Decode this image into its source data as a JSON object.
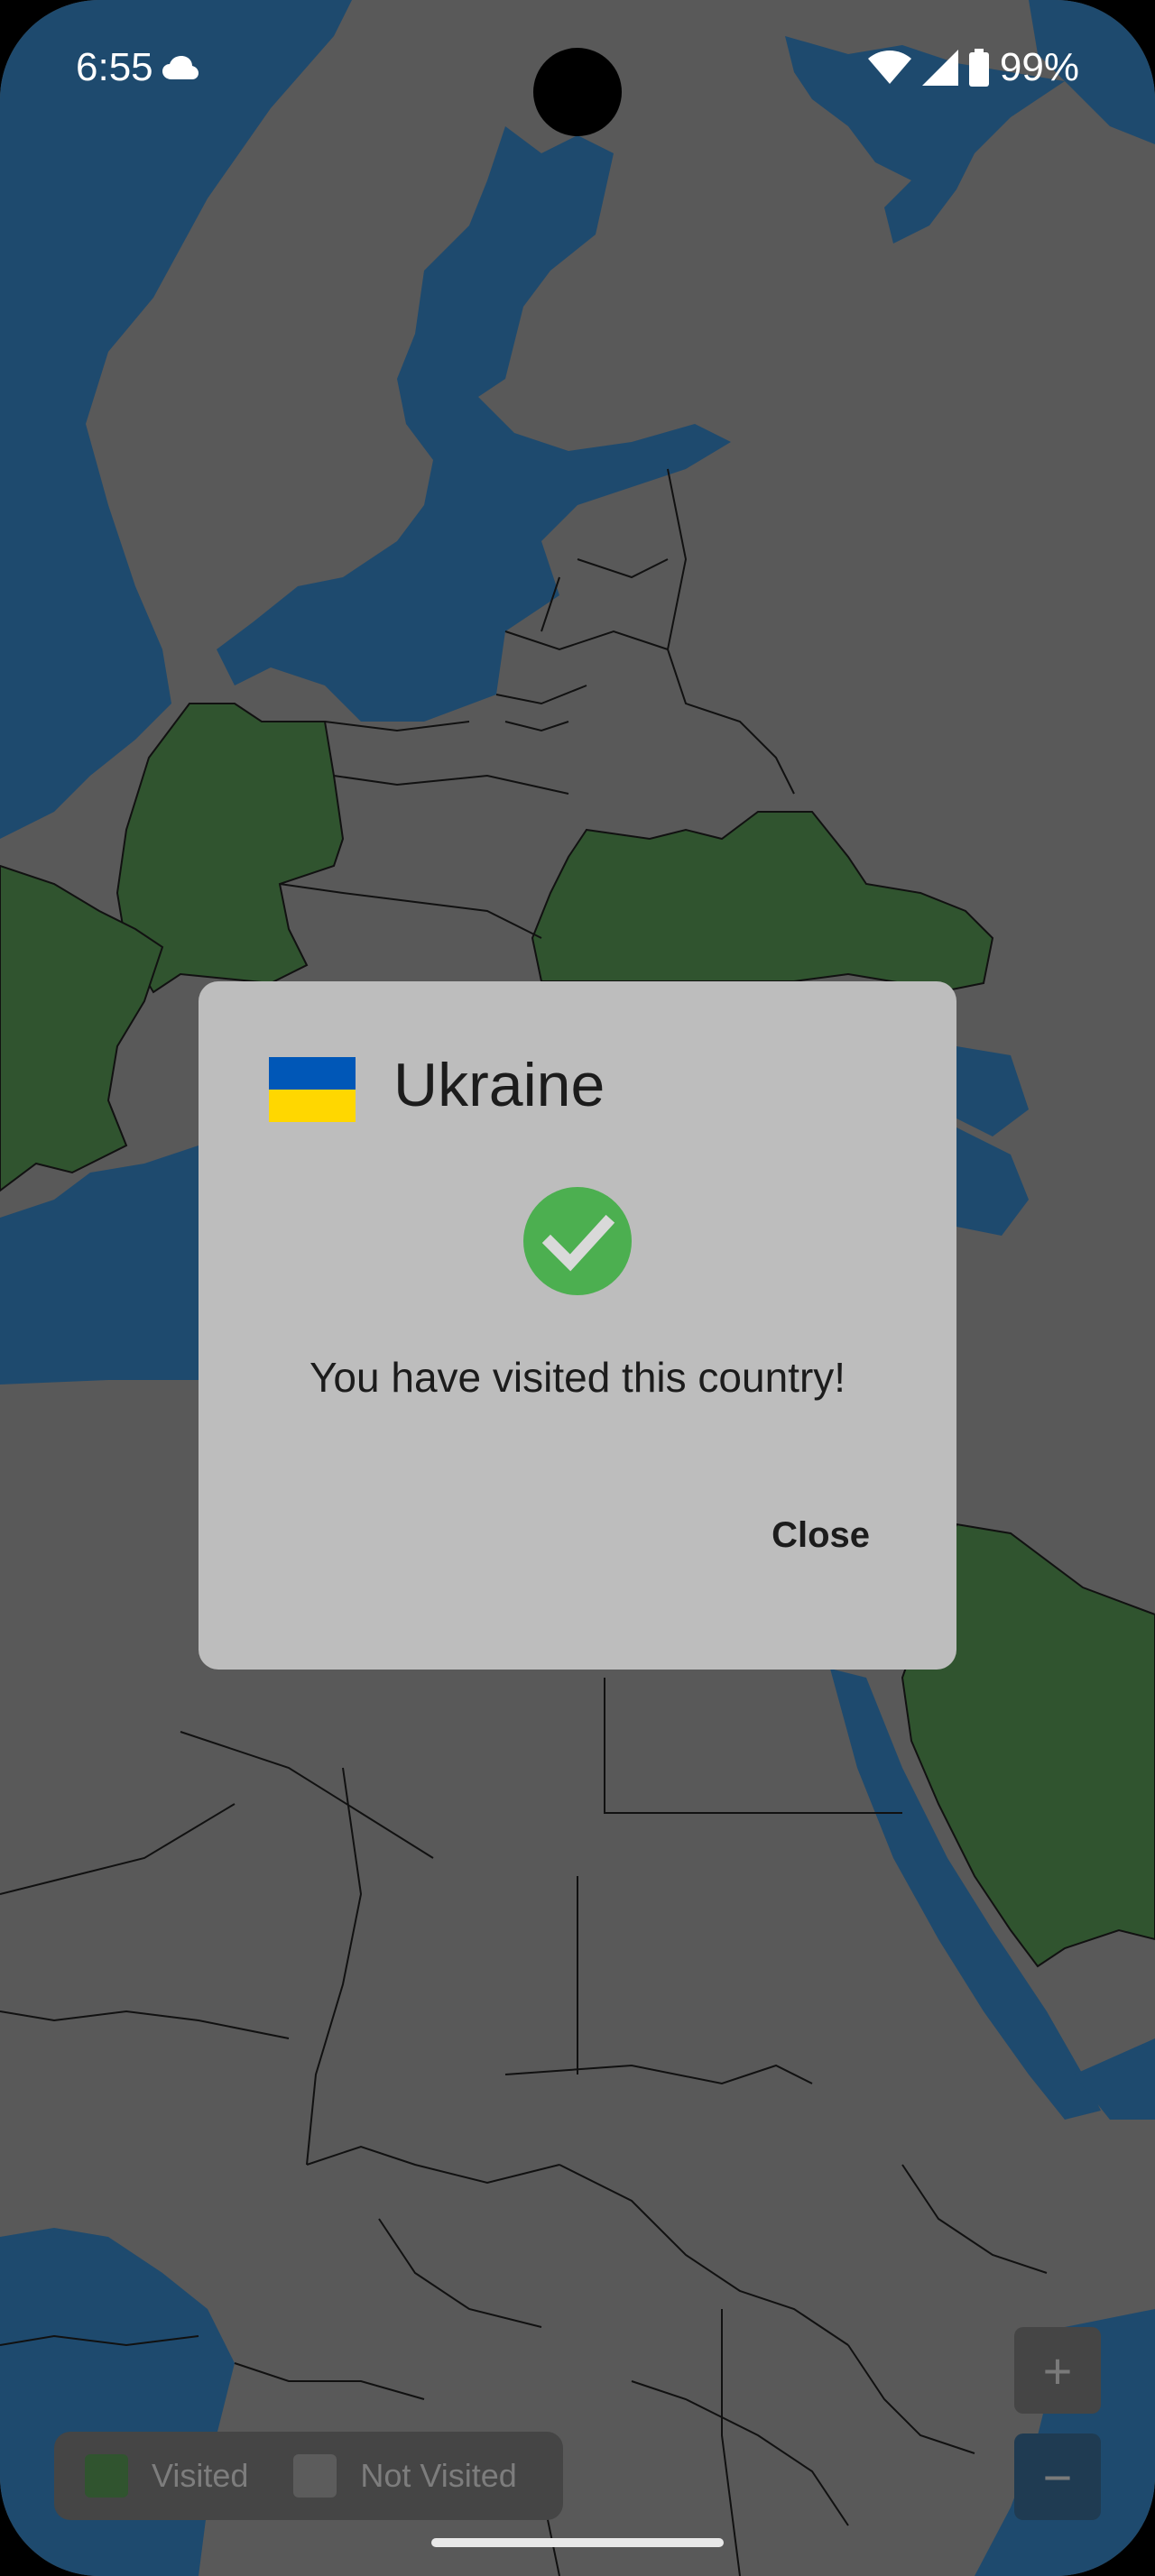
{
  "status_bar": {
    "time": "6:55",
    "battery": "99%",
    "icons": [
      "cloud-icon",
      "wifi-icon",
      "signal-icon",
      "battery-icon"
    ]
  },
  "dialog": {
    "country": "Ukraine",
    "flag_colors": [
      "#0057b7",
      "#ffd700"
    ],
    "status_icon": "check-circle-icon",
    "status_color": "#4caf50",
    "message": "You have visited this country!",
    "close_label": "Close"
  },
  "legend": {
    "visited_label": "Visited",
    "not_visited_label": "Not Visited",
    "visited_color": "#30542f",
    "not_visited_color": "#5c5c5c"
  },
  "zoom": {
    "in_label": "+",
    "out_label": "−"
  },
  "map": {
    "visited_countries": [
      "Germany",
      "France",
      "Ukraine",
      "Saudi Arabia"
    ],
    "colors": {
      "sea": "#1e4a6e",
      "land": "#595959",
      "visited": "#30542f"
    }
  }
}
